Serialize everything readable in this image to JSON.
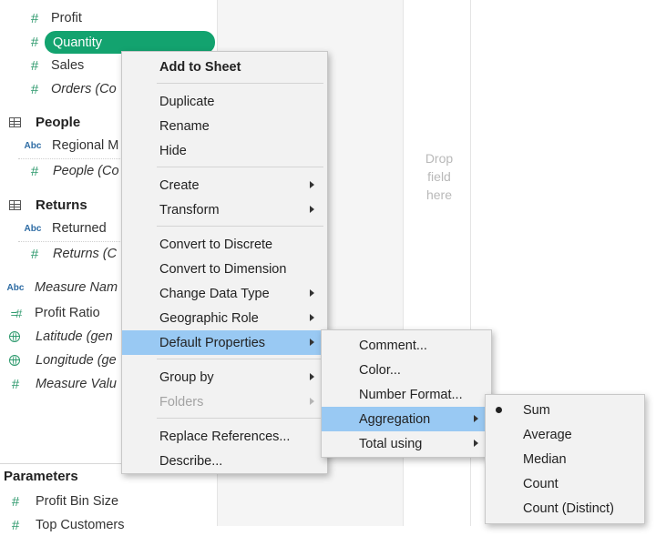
{
  "data_pane": {
    "profit": "Profit",
    "quantity": "Quantity",
    "sales": "Sales",
    "orders": "Orders (Co",
    "people_group": "People",
    "regional": "Regional M",
    "people_count": "People (Co",
    "returns_group": "Returns",
    "returned": "Returned",
    "returns_count": "Returns (C",
    "measure_names": "Measure Nam",
    "profit_ratio": "Profit Ratio",
    "latitude": "Latitude (gen",
    "longitude": "Longitude (ge",
    "measure_values": "Measure Valu",
    "parameters_title": "Parameters",
    "profit_bin": "Profit Bin Size",
    "top_customers": "Top Customers"
  },
  "shelf": {
    "drop_line1": "Drop",
    "drop_line2": "field",
    "drop_line3": "here"
  },
  "context_menu": {
    "add_to_sheet": "Add to Sheet",
    "duplicate": "Duplicate",
    "rename": "Rename",
    "hide": "Hide",
    "create": "Create",
    "transform": "Transform",
    "convert_discrete": "Convert to Discrete",
    "convert_dimension": "Convert to Dimension",
    "change_type": "Change Data Type",
    "geo_role": "Geographic Role",
    "default_props": "Default Properties",
    "group_by": "Group by",
    "folders": "Folders",
    "replace_refs": "Replace References...",
    "describe": "Describe..."
  },
  "default_properties_menu": {
    "comment": "Comment...",
    "color": "Color...",
    "number_format": "Number Format...",
    "aggregation": "Aggregation",
    "total_using": "Total using"
  },
  "aggregation_menu": {
    "selected": "Sum",
    "sum": "Sum",
    "average": "Average",
    "median": "Median",
    "count": "Count",
    "count_distinct": "Count (Distinct)"
  },
  "colors": {
    "measure_green": "#13a36f",
    "dimension_blue": "#2e6ca4",
    "menu_highlight": "#99c9f3"
  }
}
